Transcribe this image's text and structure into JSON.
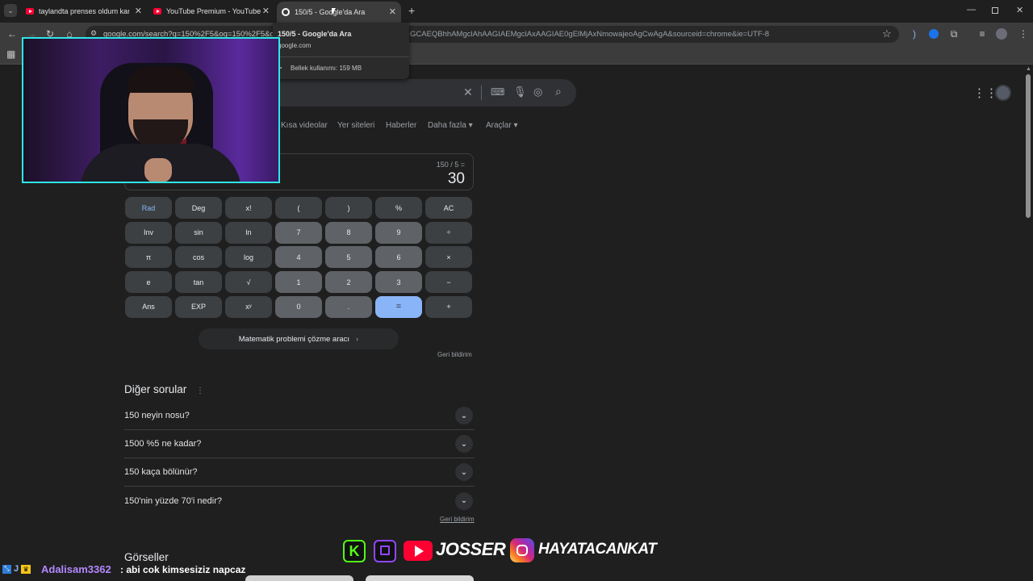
{
  "browser": {
    "tabs": [
      {
        "title": "taylandta prenses oldum karde"
      },
      {
        "title": "YouTube Premium - YouTube"
      },
      {
        "title": "150/5 - Google'da Ara"
      }
    ],
    "new_tab": "+",
    "url": "google.com/search?q=150%2F5&oq=150%2F5&g",
    "url_tail": "GCAEQBhhAMgclAhAAGIAEMgclAxAAGIAE0gElMjAxNmowajeoAgCwAgA&sourceid=chrome&ie=UTF-8",
    "tooltip": {
      "title": "150/5 - Google'da Ara",
      "domain": "google.com",
      "memory": "Bellek kullanımı: 159 MB"
    }
  },
  "google": {
    "search_tabs": [
      "Kısa videolar",
      "Yer siteleri",
      "Haberler",
      "Daha fazla",
      "Araçlar"
    ],
    "calculator": {
      "expression": "150 / 5 =",
      "result": "30",
      "keys": [
        [
          "Rad",
          "Deg",
          "x!",
          "(",
          ")",
          "%",
          "AC"
        ],
        [
          "Inv",
          "sin",
          "ln",
          "7",
          "8",
          "9",
          "÷"
        ],
        [
          "π",
          "cos",
          "log",
          "4",
          "5",
          "6",
          "×"
        ],
        [
          "e",
          "tan",
          "√",
          "1",
          "2",
          "3",
          "−"
        ],
        [
          "Ans",
          "EXP",
          "xʸ",
          "0",
          ".",
          "=",
          "+"
        ]
      ],
      "solver_button": "Matematik problemi çözme aracı",
      "feedback": "Geri bildirim"
    },
    "paa": {
      "title": "Diğer sorular",
      "questions": [
        "150 neyin nosu?",
        "1500 %5 ne kadar?",
        "150 kaça bölünür?",
        "150'nin yüzde 70'i nedir?"
      ],
      "feedback": "Geri bildirim"
    },
    "images_title": "Görseller"
  },
  "stream": {
    "chat_user": "Adalisam3362",
    "chat_message": ": abi cok kimsesiziz napcaz",
    "youtube_name": "JOSSER",
    "instagram_name": "HAYATACANKAT"
  },
  "colors": {
    "accent_blue": "#8ab4f8",
    "youtube_red": "#ff0033",
    "kick_green": "#53fc18",
    "twitch_purple": "#9146ff",
    "webcam_border": "#2ee6e6",
    "chat_user": "#b388ff"
  }
}
